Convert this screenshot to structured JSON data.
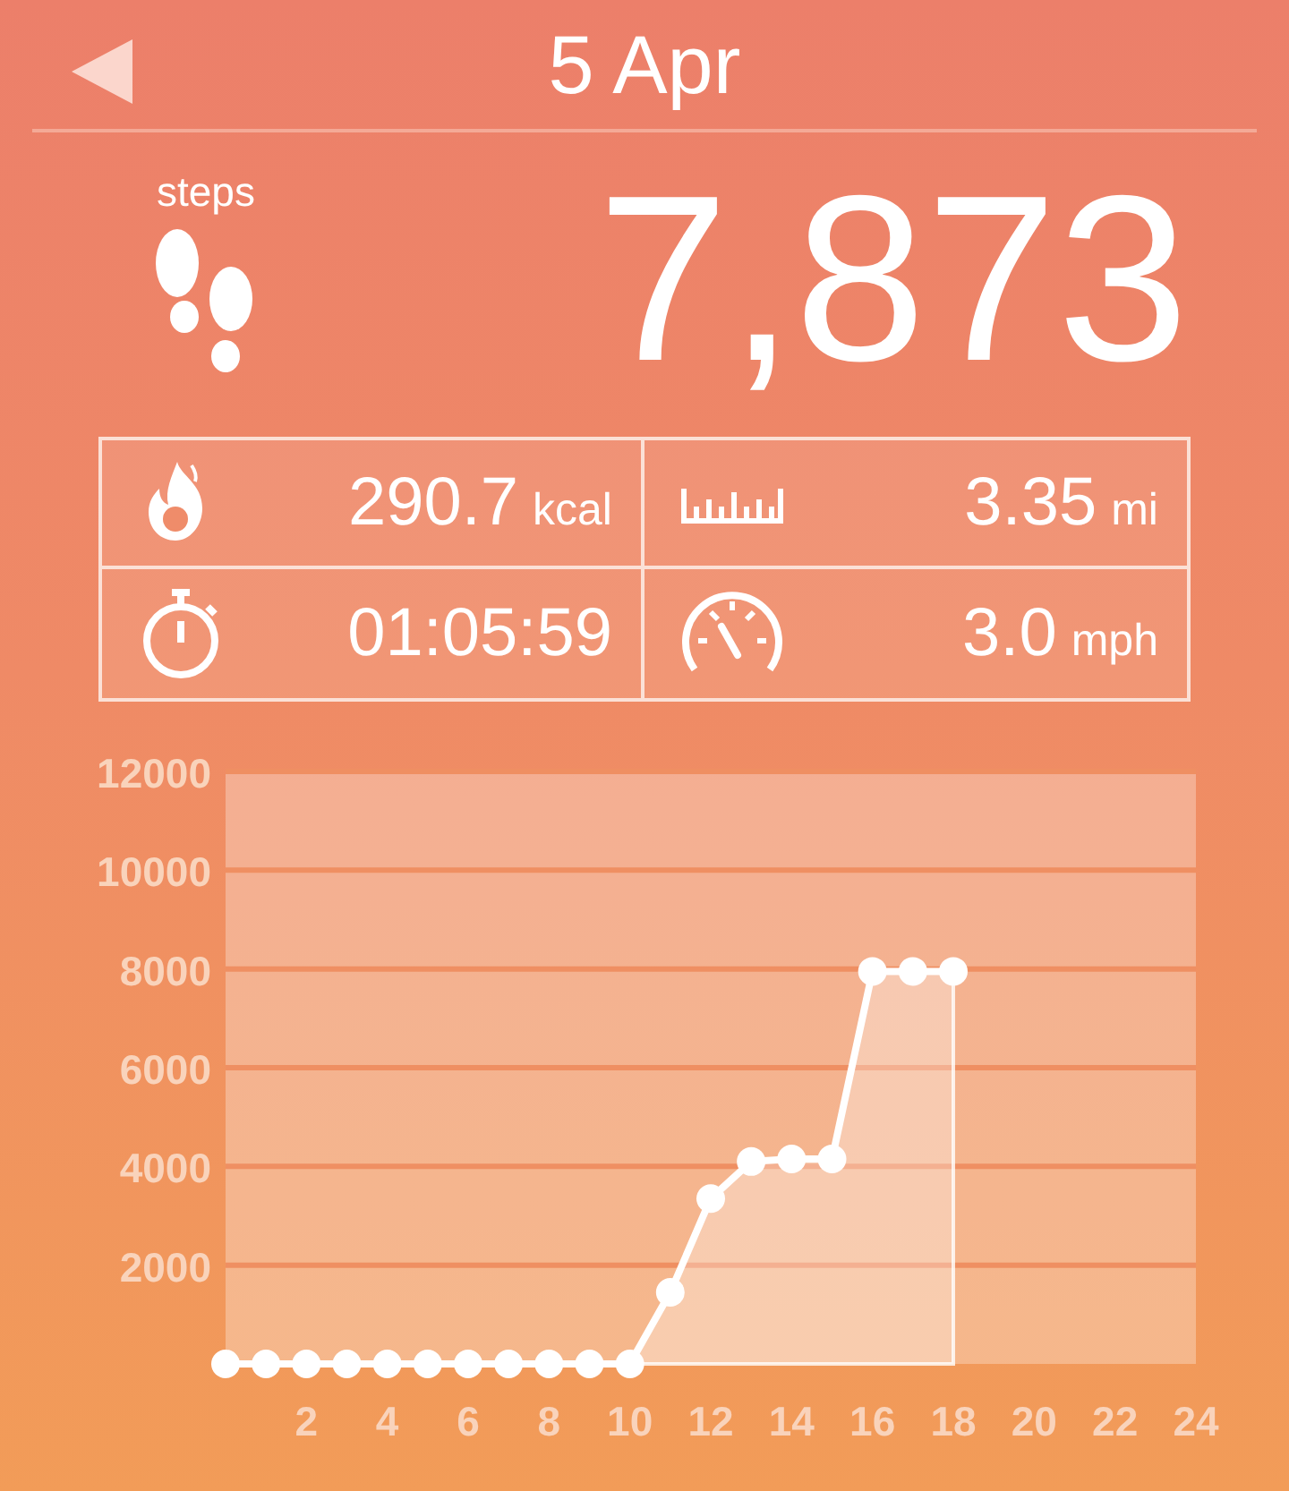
{
  "header": {
    "title": "5 Apr"
  },
  "steps": {
    "label": "steps",
    "value": "7,873"
  },
  "stats": [
    {
      "kind": "calories",
      "value": "290.7",
      "unit": "kcal"
    },
    {
      "kind": "distance",
      "value": "3.35",
      "unit": "mi"
    },
    {
      "kind": "duration",
      "value": "01:05:59"
    },
    {
      "kind": "speed",
      "value": "3.0",
      "unit": "mph"
    }
  ],
  "chart": {
    "chart_data": {
      "type": "area",
      "x": [
        0,
        1,
        2,
        3,
        4,
        5,
        6,
        7,
        8,
        9,
        10,
        11,
        12,
        13,
        14,
        15,
        16,
        17,
        18
      ],
      "grid": true,
      "series": [
        {
          "color": "#ffffff",
          "values": [
            0,
            0,
            0,
            0,
            0,
            0,
            0,
            0,
            0,
            0,
            0,
            1450,
            3350,
            4100,
            4150,
            4150,
            7950,
            7950,
            7950
          ]
        }
      ],
      "xlim": [
        0,
        24
      ],
      "ylim": [
        0,
        12000
      ],
      "xticks": [
        2,
        4,
        6,
        8,
        10,
        12,
        14,
        16,
        18,
        20,
        22,
        24
      ],
      "yticks": [
        2000,
        4000,
        6000,
        8000,
        10000,
        12000
      ]
    }
  }
}
